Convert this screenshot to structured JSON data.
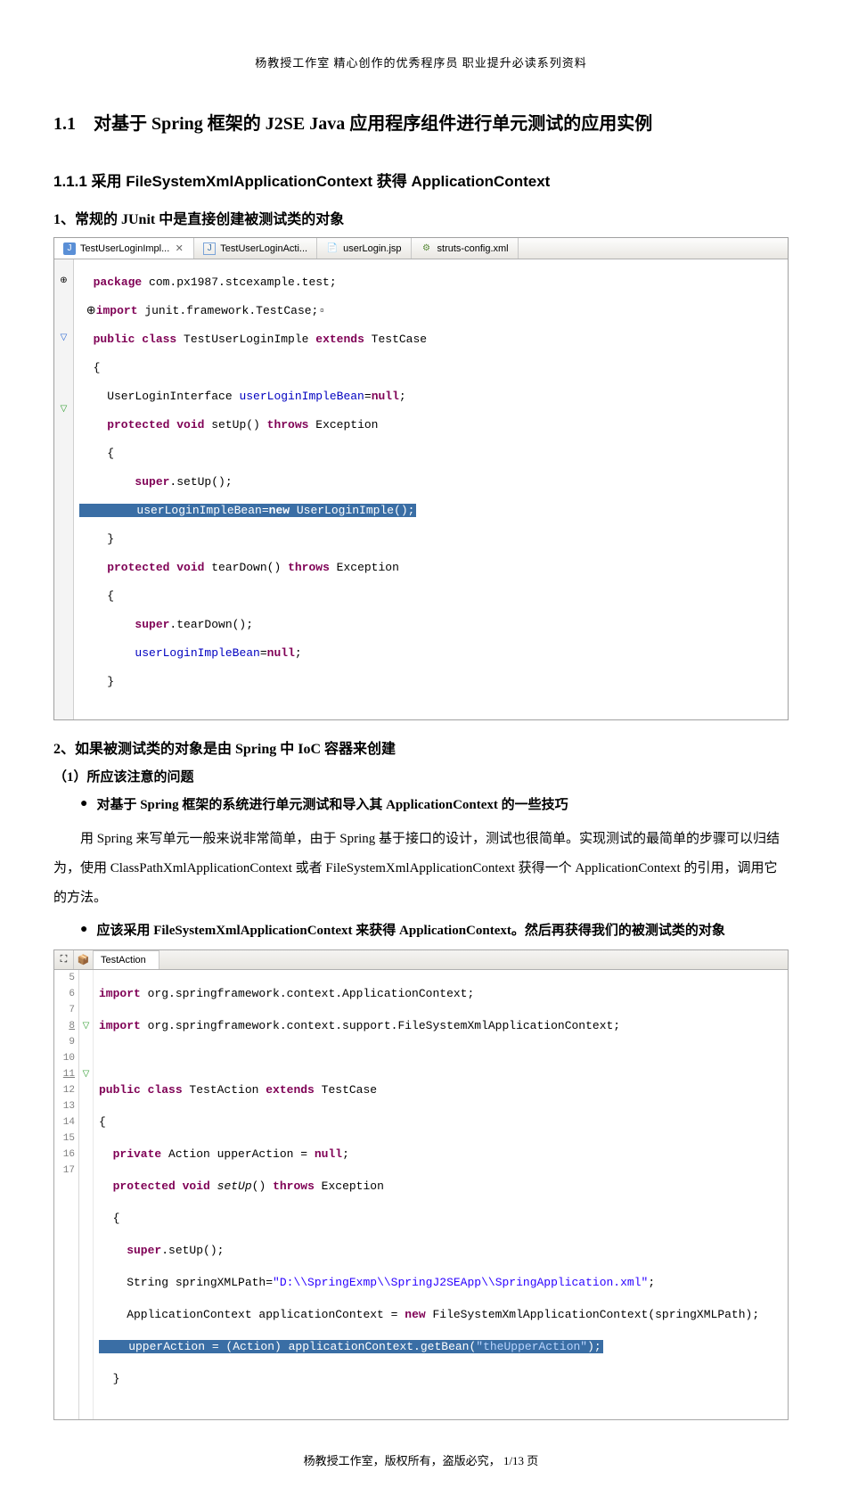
{
  "header": "杨教授工作室 精心创作的优秀程序员 职业提升必读系列资料",
  "footer": {
    "prefix": "杨教授工作室，版权所有，盗版必究， ",
    "page": "1/13 页"
  },
  "title_h1": "1.1　对基于 Spring 框架的 J2SE Java 应用程序组件进行单元测试的应用实例",
  "title_h2": "1.1.1 采用 FileSystemXmlApplicationContext 获得 ApplicationContext",
  "section1": {
    "heading": "1、常规的 JUnit 中是直接创建被测试类的对象",
    "tabs": [
      {
        "label": "TestUserLoginImpl...",
        "active": true
      },
      {
        "label": "TestUserLoginActi...",
        "active": false
      },
      {
        "label": "userLogin.jsp",
        "active": false
      },
      {
        "label": "struts-config.xml",
        "active": false
      }
    ],
    "code": {
      "l1_kw_package": "package",
      "l1_rest": " com.px1987.stcexample.test;",
      "l2_kw_import": "import",
      "l2_rest": " junit.framework.TestCase;",
      "l3_kw_public": "public",
      "l3_kw_class": " class ",
      "l3_name": "TestUserLoginImple ",
      "l3_kw_extends": "extends",
      "l3_rest": " TestCase",
      "l4": "{",
      "l5_a": "    UserLoginInterface ",
      "l5_var": "userLoginImpleBean",
      "l5_b": "=",
      "l5_kw_null": "null",
      "l5_c": ";",
      "l6_kw": "    protected void",
      "l6_rest": " setUp() ",
      "l6_kw2": "throws",
      "l6_rest2": " Exception",
      "l7": "    {",
      "l8_kw": "        super",
      "l8_rest": ".setUp();",
      "l9_hl": "        userLoginImpleBean=",
      "l9_kw_new": "new",
      "l9_hl2": " UserLoginImple();",
      "l10": "    }",
      "l11_kw": "    protected void",
      "l11_rest": " tearDown() ",
      "l11_kw2": "throws",
      "l11_rest2": " Exception",
      "l12": "    {",
      "l13_kw": "        super",
      "l13_rest": ".tearDown();",
      "l14_a": "        ",
      "l14_var": "userLoginImpleBean",
      "l14_b": "=",
      "l14_kw_null": "null",
      "l14_c": ";",
      "l15": "    }"
    }
  },
  "section2": {
    "heading": "2、如果被测试类的对象是由 Spring 中 IoC 容器来创建",
    "sub": "（1）所应该注意的问题",
    "bullet1": "对基于 Spring 框架的系统进行单元测试和导入其 ApplicationContext 的一些技巧",
    "para1": "用 Spring 来写单元一般来说非常简单，由于 Spring 基于接口的设计，测试也很简单。实现测试的最简单的步骤可以归结为，使用 ClassPathXmlApplicationContext 或者 FileSystemXmlApplicationContext 获得一个 ApplicationContext 的引用，调用它的方法。",
    "bullet2": "应该采用 FileSystemXmlApplicationContext 来获得 ApplicationContext。然后再获得我们的被测试类的对象",
    "tab": "TestAction",
    "lines": [
      "5",
      "6",
      "7",
      "8",
      "9",
      "10",
      "11",
      "12",
      "13",
      "14",
      "15",
      "16",
      "17"
    ],
    "code": {
      "l5_kw": "import",
      "l5_rest": " org.springframework.context.ApplicationContext;",
      "l6_kw": "import",
      "l6_rest": " org.springframework.context.support.FileSystemXmlApplicationContext;",
      "l8_kw1": "public",
      "l8_kw2": " class ",
      "l8_name": "TestAction ",
      "l8_kw3": "extends",
      "l8_rest": " TestCase",
      "l9": "{",
      "l10_kw": "  private",
      "l10_rest": " Action upperAction = ",
      "l10_kw2": "null",
      "l10_rest2": ";",
      "l11_kw": "  protected",
      "l11_kw2": " void ",
      "l11_name": "setUp",
      "l11_rest": "() ",
      "l11_kw3": "throws",
      "l11_rest2": " Exception",
      "l12": "  {",
      "l13_kw": "    super",
      "l13_rest": ".setUp();",
      "l14_a": "    String springXMLPath=",
      "l14_str": "\"D:\\\\SpringExmp\\\\SpringJ2SEApp\\\\SpringApplication.xml\"",
      "l14_b": ";",
      "l15_a": "    ApplicationContext applicationContext = ",
      "l15_kw": "new",
      "l15_b": " FileSystemXmlApplicationContext(springXMLPath);",
      "l16_hl_a": "    upperAction = (Action) applicationContext.getBean(",
      "l16_hl_str": "\"theUpperAction\"",
      "l16_hl_b": ");",
      "l17": "  }"
    }
  }
}
